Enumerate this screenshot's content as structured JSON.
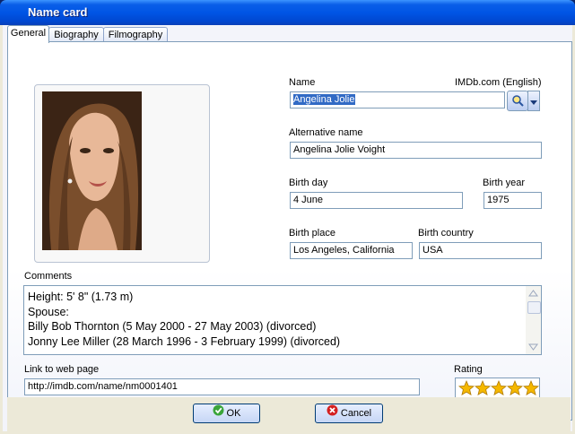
{
  "window": {
    "title": "Name card"
  },
  "tabs": [
    {
      "label": "General",
      "active": true
    },
    {
      "label": "Biography",
      "active": false
    },
    {
      "label": "Filmography",
      "active": false
    }
  ],
  "fields": {
    "name": {
      "label": "Name",
      "value": "Angelina Jolie",
      "source": "IMDb.com (English)"
    },
    "alternative_name": {
      "label": "Alternative name",
      "value": "Angelina Jolie Voight"
    },
    "birth_day": {
      "label": "Birth day",
      "value": "4 June"
    },
    "birth_year": {
      "label": "Birth year",
      "value": "1975"
    },
    "birth_place": {
      "label": "Birth place",
      "value": "Los Angeles, California"
    },
    "birth_country": {
      "label": "Birth country",
      "value": "USA"
    },
    "comments": {
      "label": "Comments",
      "lines": [
        "Height: 5' 8\" (1.73 m)",
        "Spouse:",
        "Billy Bob Thornton (5 May 2000 - 27 May 2003) (divorced)",
        "Jonny Lee Miller (28 March 1996 - 3 February 1999) (divorced)"
      ]
    },
    "link": {
      "label": "Link to web page",
      "value": "http://imdb.com/name/nm0001401"
    },
    "rating": {
      "label": "Rating",
      "stars": 5,
      "max": 5
    }
  },
  "buttons": {
    "ok": "OK",
    "cancel": "Cancel"
  },
  "colors": {
    "titlebar": "#0055e5",
    "star": "#f5b800",
    "ok_icon": "#3aa53a",
    "cancel_icon": "#d42020"
  }
}
